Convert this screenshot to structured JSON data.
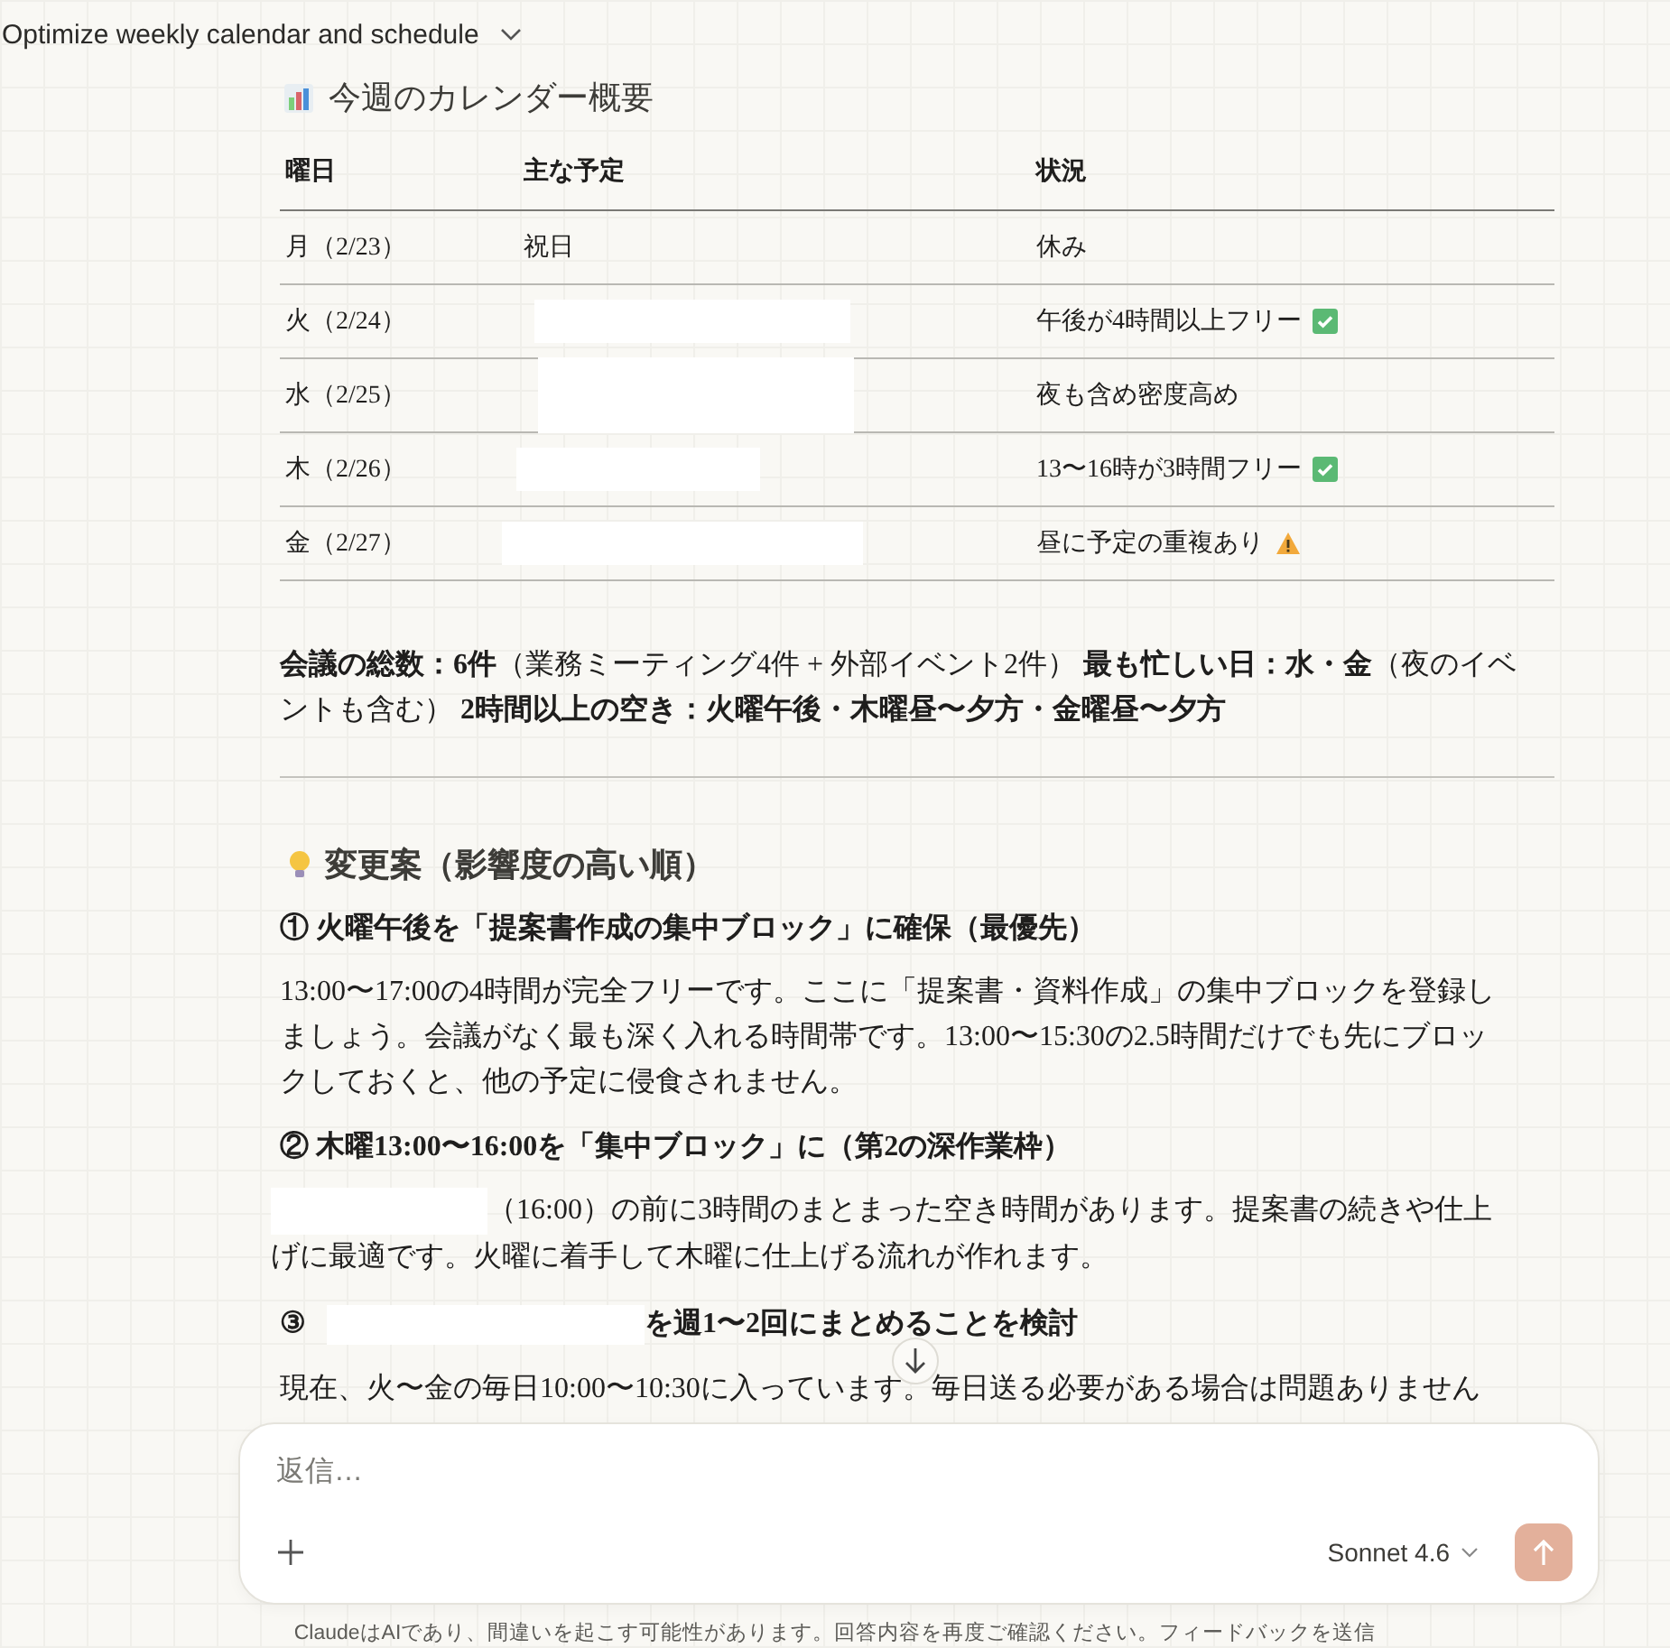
{
  "header": {
    "title": "Optimize weekly calendar and schedule"
  },
  "calendar": {
    "heading": "今週のカレンダー概要",
    "columns": [
      "曜日",
      "主な予定",
      "状況"
    ],
    "rows": [
      {
        "day": "月（2/23）",
        "plan": {
          "kind": "text",
          "text": "祝日"
        },
        "status": "休み",
        "kind": "plain"
      },
      {
        "day": "火（2/24）",
        "plan": {
          "kind": "redacted"
        },
        "status": "午後が4時間以上フリー",
        "kind": "check"
      },
      {
        "day": "水（2/25）",
        "plan": {
          "kind": "redacted"
        },
        "status": "夜も含め密度高め",
        "kind": "plain"
      },
      {
        "day": "木（2/26）",
        "plan": {
          "kind": "redacted"
        },
        "status": "13〜16時が3時間フリー",
        "kind": "check"
      },
      {
        "day": "金（2/27）",
        "plan": {
          "kind": "redacted"
        },
        "status": "昼に予定の重複あり",
        "kind": "warning"
      }
    ]
  },
  "summary": "**会議の総数：6件**（業務ミーティング4件 + 外部イベント2件） **最も忙しい日：水・金**（夜のイベントも含む） **2時間以上の空き：火曜午後・木曜昼〜夕方・金曜昼〜夕方**",
  "proposals": {
    "heading": "変更案（影響度の高い順）",
    "items": [
      {
        "title": [
          {
            "kind": "text",
            "text": "① 火曜午後を「提案書作成の集中ブロック」に確保（最優先）"
          }
        ],
        "body": [
          {
            "kind": "text",
            "text": "13:00〜17:00の4時間が完全フリーです。ここに「提案書・資料作成」の集中ブロックを登録しましょう。会議がなく最も深く入れる時間帯です。13:00〜15:30の2.5時間だけでも先にブロックしておくと、他の予定に侵食されません。"
          }
        ]
      },
      {
        "title": [
          {
            "kind": "text",
            "text": "② 木曜13:00〜16:00を「集中ブロック」に（第2の深作業枠）"
          }
        ],
        "body": [
          {
            "kind": "redacted"
          },
          {
            "kind": "text",
            "text": "（16:00）の前に3時間のまとまった空き時間があります。提案書の続きや仕上げに最適です。火曜に着手して木曜に仕上げる流れが作れます。"
          }
        ]
      },
      {
        "title": [
          {
            "kind": "text",
            "text": "③"
          },
          {
            "kind": "redacted"
          },
          {
            "kind": "text",
            "text": "を週1〜2回にまとめることを検討"
          }
        ],
        "body": [
          {
            "kind": "text",
            "text": "現在、火〜金の毎日10:00〜10:30に入っています。毎日送る必要がある場合は問題ありません"
          }
        ]
      }
    ]
  },
  "composer": {
    "placeholder": "返信…",
    "model": "Sonnet 4.6",
    "send_disabled": true
  },
  "footer": {
    "text": "ClaudeはAIであり、間違いを起こす可能性があります。回答内容を再度ご確認ください。",
    "link": "フィードバックを送信"
  }
}
